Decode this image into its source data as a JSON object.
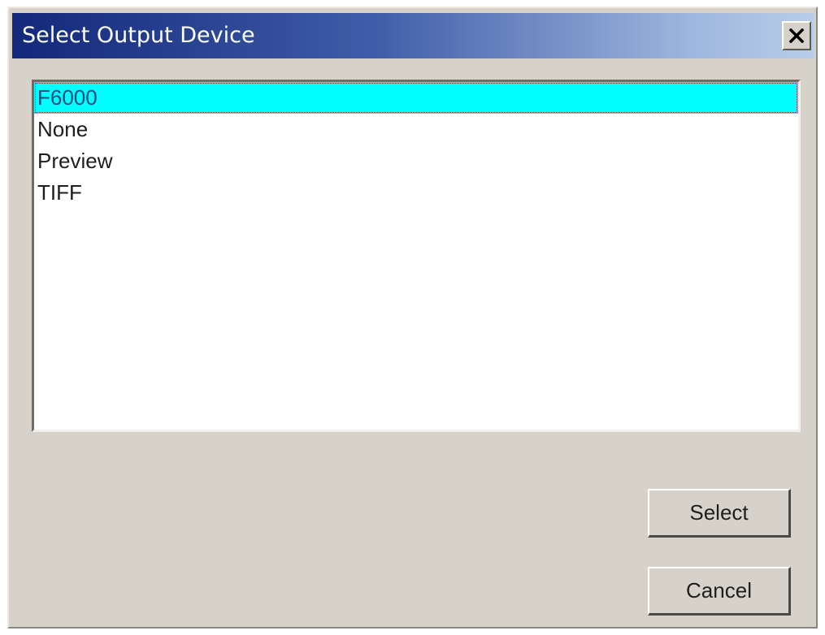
{
  "window": {
    "title": "Select Output Device",
    "close_glyph": "close-icon"
  },
  "device_list": {
    "items": [
      {
        "label": "F6000",
        "selected": true
      },
      {
        "label": "None",
        "selected": false
      },
      {
        "label": "Preview",
        "selected": false
      },
      {
        "label": "TIFF",
        "selected": false
      }
    ]
  },
  "buttons": {
    "select_label": "Select",
    "cancel_label": "Cancel"
  },
  "colors": {
    "title_gradient_start": "#13287a",
    "title_gradient_end": "#b7cde9",
    "selection": "#00ffff",
    "dialog_face": "#d6d2c9"
  }
}
